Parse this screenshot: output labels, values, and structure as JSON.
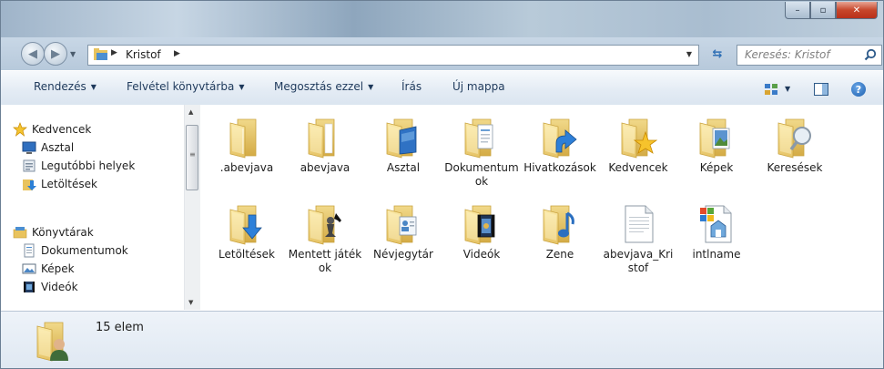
{
  "window": {
    "buttons": {
      "minimize": "–",
      "maximize": "▫",
      "close": "✕"
    }
  },
  "address": {
    "crumb": "Kristof",
    "search_placeholder": "Keresés: Kristof"
  },
  "toolbar": {
    "rendezes": "Rendezés",
    "felvetel": "Felvétel könyvtárba",
    "megosztas": "Megosztás ezzel",
    "iras": "Írás",
    "uj_mappa": "Új mappa"
  },
  "nav": {
    "kedvencek": "Kedvencek",
    "asztal": "Asztal",
    "legutobbi": "Legutóbbi helyek",
    "letoltesek": "Letöltések",
    "konyvtarak": "Könyvtárak",
    "dokumentumok": "Dokumentumok",
    "kepek": "Képek",
    "videok": "Videók"
  },
  "files": [
    {
      "label": ".abevjava",
      "icon": "folder-icon"
    },
    {
      "label": "abevjava",
      "icon": "folder-icon"
    },
    {
      "label": "Asztal",
      "icon": "desktop-folder-icon"
    },
    {
      "label": "Dokumentumok",
      "icon": "documents-folder-icon"
    },
    {
      "label": "Hivatkozások",
      "icon": "links-folder-icon"
    },
    {
      "label": "Kedvencek",
      "icon": "favorites-folder-icon"
    },
    {
      "label": "Képek",
      "icon": "pictures-folder-icon"
    },
    {
      "label": "Keresések",
      "icon": "searches-folder-icon"
    },
    {
      "label": "Letöltések",
      "icon": "downloads-folder-icon"
    },
    {
      "label": "Mentett játékok",
      "icon": "saved-games-folder-icon"
    },
    {
      "label": "Névjegytár",
      "icon": "contacts-folder-icon"
    },
    {
      "label": "Videók",
      "icon": "videos-folder-icon"
    },
    {
      "label": "Zene",
      "icon": "music-folder-icon"
    },
    {
      "label": "abevjava_Kristof",
      "icon": "text-file-icon"
    },
    {
      "label": "intlname",
      "icon": "config-file-icon"
    }
  ],
  "details": {
    "count": "15 elem"
  },
  "colors": {
    "folder": "#f3d77e",
    "folder_dark": "#d9b54e",
    "accent": "#1e395b"
  }
}
